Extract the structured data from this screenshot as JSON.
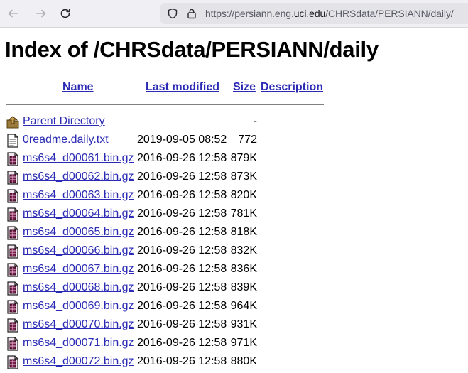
{
  "browser": {
    "url_prefix": "https://persiann.eng.",
    "url_domain": "uci.edu",
    "url_path": "/CHRSdata/PERSIANN/daily/"
  },
  "page": {
    "title": "Index of /CHRSdata/PERSIANN/daily",
    "columns": {
      "name": "Name",
      "last_modified": "Last modified",
      "size": "Size",
      "description": "Description"
    },
    "parent": {
      "name": "Parent Directory",
      "size": "-"
    },
    "files": [
      {
        "icon": "text-file-icon",
        "name": "0readme.daily.txt",
        "date": "2019-09-05 08:52",
        "size": "772"
      },
      {
        "icon": "archive-file-icon",
        "name": "ms6s4_d00061.bin.gz",
        "date": "2016-09-26 12:58",
        "size": "879K"
      },
      {
        "icon": "archive-file-icon",
        "name": "ms6s4_d00062.bin.gz",
        "date": "2016-09-26 12:58",
        "size": "873K"
      },
      {
        "icon": "archive-file-icon",
        "name": "ms6s4_d00063.bin.gz",
        "date": "2016-09-26 12:58",
        "size": "820K"
      },
      {
        "icon": "archive-file-icon",
        "name": "ms6s4_d00064.bin.gz",
        "date": "2016-09-26 12:58",
        "size": "781K"
      },
      {
        "icon": "archive-file-icon",
        "name": "ms6s4_d00065.bin.gz",
        "date": "2016-09-26 12:58",
        "size": "818K"
      },
      {
        "icon": "archive-file-icon",
        "name": "ms6s4_d00066.bin.gz",
        "date": "2016-09-26 12:58",
        "size": "832K"
      },
      {
        "icon": "archive-file-icon",
        "name": "ms6s4_d00067.bin.gz",
        "date": "2016-09-26 12:58",
        "size": "836K"
      },
      {
        "icon": "archive-file-icon",
        "name": "ms6s4_d00068.bin.gz",
        "date": "2016-09-26 12:58",
        "size": "839K"
      },
      {
        "icon": "archive-file-icon",
        "name": "ms6s4_d00069.bin.gz",
        "date": "2016-09-26 12:58",
        "size": "964K"
      },
      {
        "icon": "archive-file-icon",
        "name": "ms6s4_d00070.bin.gz",
        "date": "2016-09-26 12:58",
        "size": "931K"
      },
      {
        "icon": "archive-file-icon",
        "name": "ms6s4_d00071.bin.gz",
        "date": "2016-09-26 12:58",
        "size": "971K"
      },
      {
        "icon": "archive-file-icon",
        "name": "ms6s4_d00072.bin.gz",
        "date": "2016-09-26 12:58",
        "size": "880K"
      }
    ]
  }
}
